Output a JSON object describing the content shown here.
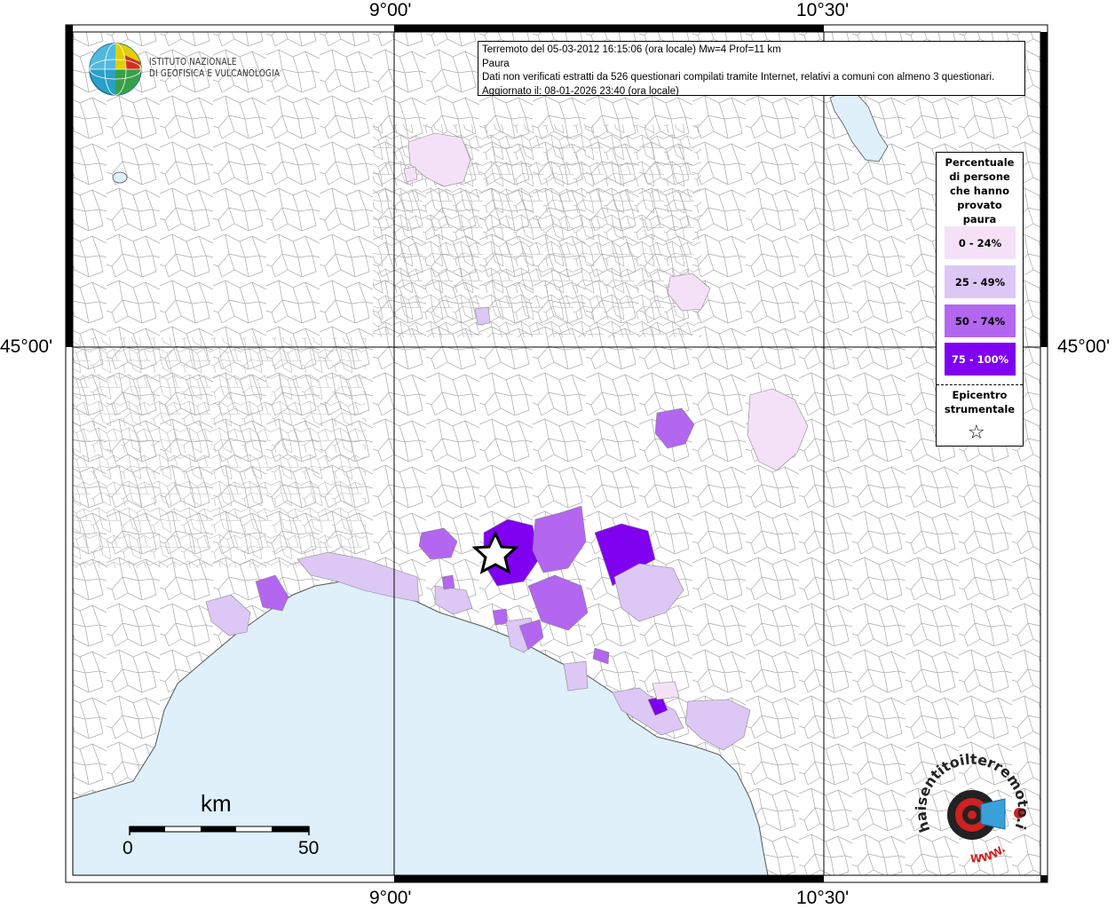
{
  "info": {
    "line1": "Terremoto del 05-03-2012 16:15:06 (ora locale) Mw=4 Prof=11 km",
    "line2": "Paura",
    "line3": "Dati non verificati estratti da 526 questionari compilati tramite Internet, relativi a comuni con almeno 3 questionari.",
    "line4": "Aggiornato il: 08-01-2026 23:40 (ora locale)"
  },
  "axes": {
    "top_left": "9°00'",
    "top_right": "10°30'",
    "bottom_left": "9°00'",
    "bottom_right": "10°30'",
    "left": "45°00'",
    "right": "45°00'"
  },
  "legend": {
    "title_lines": [
      "Percentuale",
      "di persone",
      "che hanno",
      "provato",
      "paura"
    ],
    "classes": [
      {
        "label": "0 - 24%",
        "color": "#f5e1f7"
      },
      {
        "label": "25 - 49%",
        "color": "#dcc7f5"
      },
      {
        "label": "50 - 74%",
        "color": "#b366f0"
      },
      {
        "label": "75 - 100%",
        "color": "#8000f0"
      }
    ],
    "epicenter_lines": [
      "Epicentro",
      "strumentale"
    ],
    "epicenter_symbol": "☆"
  },
  "logo_ingv": {
    "line1": "ISTITUTO NAZIONALE",
    "line2": "DI GEOFISICA E VULCANOLOGIA"
  },
  "logo_hsit": {
    "text": "haisentitoilterremoto.it",
    "url_text": "WWW."
  },
  "scale_bar": {
    "unit": "km",
    "start": "0",
    "end": "50"
  },
  "colors": {
    "sea": "#dff0fb",
    "lake": "#dff0fb",
    "border": "#999999"
  }
}
